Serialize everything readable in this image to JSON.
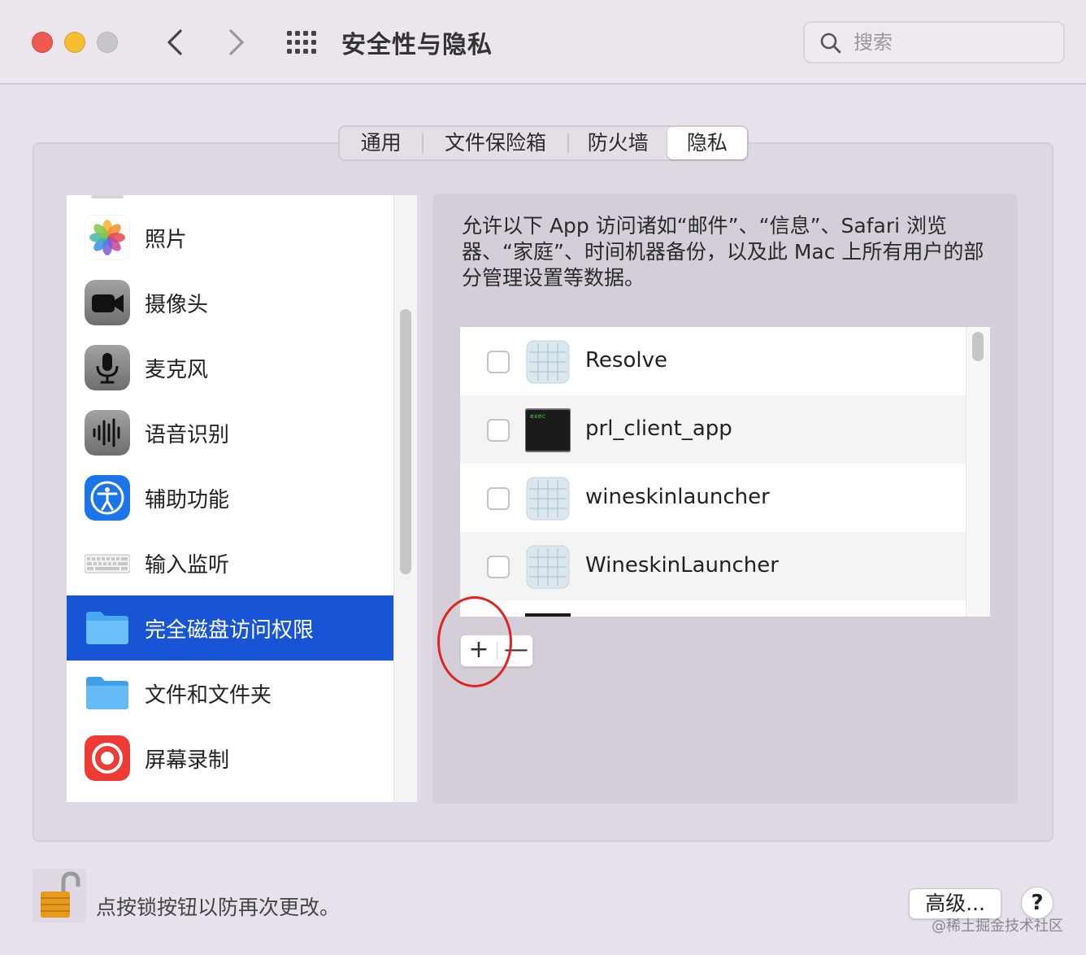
{
  "window": {
    "title": "安全性与隐私",
    "search_placeholder": "搜索"
  },
  "tabs": [
    {
      "label": "通用",
      "selected": false
    },
    {
      "label": "文件保险箱",
      "selected": false
    },
    {
      "label": "防火墙",
      "selected": false
    },
    {
      "label": "隐私",
      "selected": true
    }
  ],
  "sidebar": {
    "items": [
      {
        "label": "照片",
        "icon": "photos-icon"
      },
      {
        "label": "摄像头",
        "icon": "camera-icon"
      },
      {
        "label": "麦克风",
        "icon": "microphone-icon"
      },
      {
        "label": "语音识别",
        "icon": "speech-recognition-icon"
      },
      {
        "label": "辅助功能",
        "icon": "accessibility-icon"
      },
      {
        "label": "输入监听",
        "icon": "keyboard-icon"
      },
      {
        "label": "完全磁盘访问权限",
        "icon": "folder-icon",
        "selected": true
      },
      {
        "label": "文件和文件夹",
        "icon": "folder-icon"
      },
      {
        "label": "屏幕录制",
        "icon": "screen-recording-icon"
      }
    ]
  },
  "content": {
    "description": "允许以下 App 访问诸如“邮件”、“信息”、Safari 浏览器、“家庭”、时间机器备份，以及此 Mac 上所有用户的部分管理设置等数据。",
    "apps": [
      {
        "name": "Resolve",
        "checked": false,
        "icon": "app-generic-icon"
      },
      {
        "name": "prl_client_app",
        "checked": false,
        "icon": "exec-icon",
        "icon_text": "exec"
      },
      {
        "name": "wineskinlauncher",
        "checked": false,
        "icon": "app-generic-icon"
      },
      {
        "name": "WineskinLauncher",
        "checked": false,
        "icon": "app-generic-icon"
      }
    ],
    "add_label": "+",
    "remove_label": "—"
  },
  "footer": {
    "lock_text": "点按锁按钮以防再次更改。",
    "advanced_label": "高级...",
    "help_label": "?",
    "watermark": "@稀土掘金技术社区"
  },
  "colors": {
    "selection": "#1855d6",
    "annotation": "#e0231f"
  }
}
